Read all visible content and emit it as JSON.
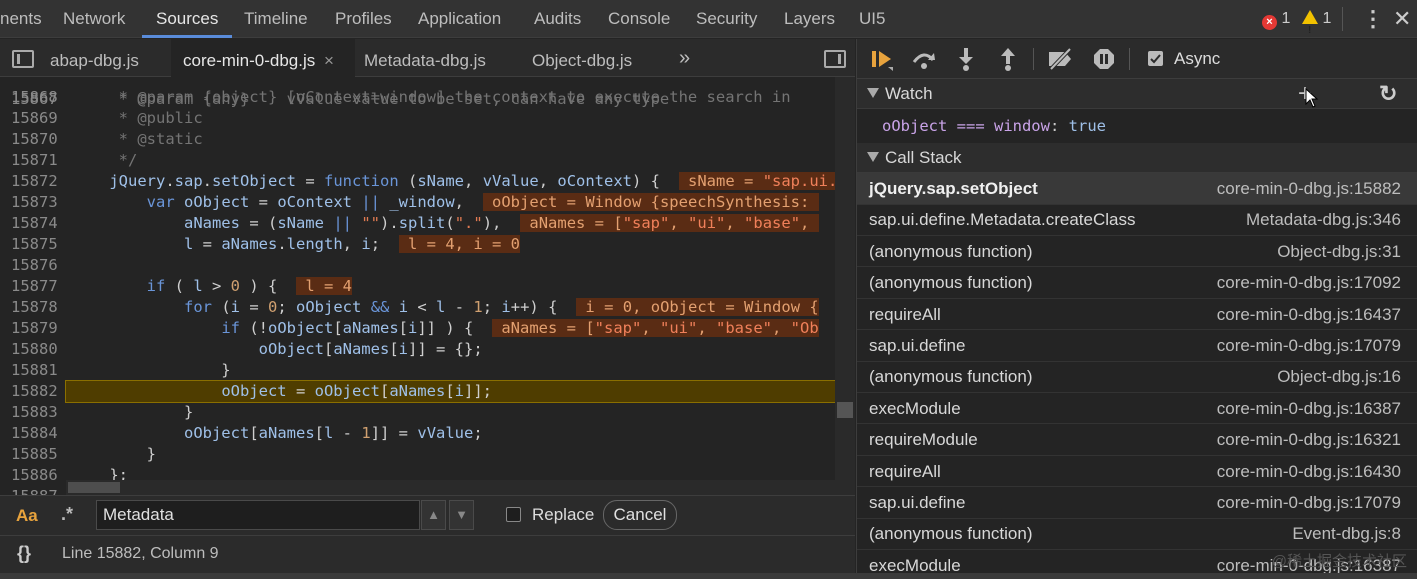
{
  "panel_tabs": [
    {
      "label": "nents"
    },
    {
      "label": "Network"
    },
    {
      "label": "Sources"
    },
    {
      "label": "Timeline"
    },
    {
      "label": "Profiles"
    },
    {
      "label": "Application"
    },
    {
      "label": "Audits"
    },
    {
      "label": "Console"
    },
    {
      "label": "Security"
    },
    {
      "label": "Layers"
    },
    {
      "label": "UI5"
    }
  ],
  "active_panel": "Sources",
  "counters": {
    "errors": "1",
    "warnings": "1"
  },
  "file_tabs": [
    {
      "label": "abap-dbg.js"
    },
    {
      "label": "core-min-0-dbg.js",
      "close": "×"
    },
    {
      "label": "Metadata-dbg.js"
    },
    {
      "label": "Object-dbg.js"
    }
  ],
  "more_tabs": "»",
  "code": {
    "top_partial": {
      "num": "15867",
      "text": "     * @param {any}    vValue value to be set, can have any type"
    },
    "lines": [
      {
        "num": "15868"
      },
      {
        "num": "15869"
      },
      {
        "num": "15870"
      },
      {
        "num": "15871"
      },
      {
        "num": "15872"
      },
      {
        "num": "15873"
      },
      {
        "num": "15874"
      },
      {
        "num": "15875"
      },
      {
        "num": "15876"
      },
      {
        "num": "15877"
      },
      {
        "num": "15878"
      },
      {
        "num": "15879"
      },
      {
        "num": "15880"
      },
      {
        "num": "15881"
      },
      {
        "num": "15882"
      },
      {
        "num": "15883"
      },
      {
        "num": "15884"
      },
      {
        "num": "15885"
      },
      {
        "num": "15886"
      }
    ],
    "bottom_partial": {
      "num": "15887"
    },
    "current_line": "15882"
  },
  "search": {
    "case_label": "Aa",
    "regex_label": ".*",
    "value": "Metadata",
    "up": "▲",
    "down": "▼",
    "replace_label": "Replace",
    "cancel_label": "Cancel"
  },
  "status": {
    "braces": "{}",
    "position": "Line 15882, Column 9"
  },
  "debugger": {
    "async_label": "Async"
  },
  "watch": {
    "title": "Watch",
    "add": "+",
    "refresh": "↻",
    "expr": "oObject ===  window",
    "colon": ":",
    "value": "true"
  },
  "callstack": {
    "title": "Call Stack",
    "frames": [
      {
        "fn": "jQuery.sap.setObject",
        "loc": "core-min-0-dbg.js:15882"
      },
      {
        "fn": "sap.ui.define.Metadata.createClass",
        "loc": "Metadata-dbg.js:346"
      },
      {
        "fn": "(anonymous function)",
        "loc": "Object-dbg.js:31"
      },
      {
        "fn": "(anonymous function)",
        "loc": "core-min-0-dbg.js:17092"
      },
      {
        "fn": "requireAll",
        "loc": "core-min-0-dbg.js:16437"
      },
      {
        "fn": "sap.ui.define",
        "loc": "core-min-0-dbg.js:17079"
      },
      {
        "fn": "(anonymous function)",
        "loc": "Object-dbg.js:16"
      },
      {
        "fn": "execModule",
        "loc": "core-min-0-dbg.js:16387"
      },
      {
        "fn": "requireModule",
        "loc": "core-min-0-dbg.js:16321"
      },
      {
        "fn": "requireAll",
        "loc": "core-min-0-dbg.js:16430"
      },
      {
        "fn": "sap.ui.define",
        "loc": "core-min-0-dbg.js:17079"
      },
      {
        "fn": "(anonymous function)",
        "loc": "Event-dbg.js:8"
      },
      {
        "fn": "execModule",
        "loc": "core-min-0-dbg.js:16387"
      }
    ]
  },
  "watermark": "@稀土掘金技术社区"
}
